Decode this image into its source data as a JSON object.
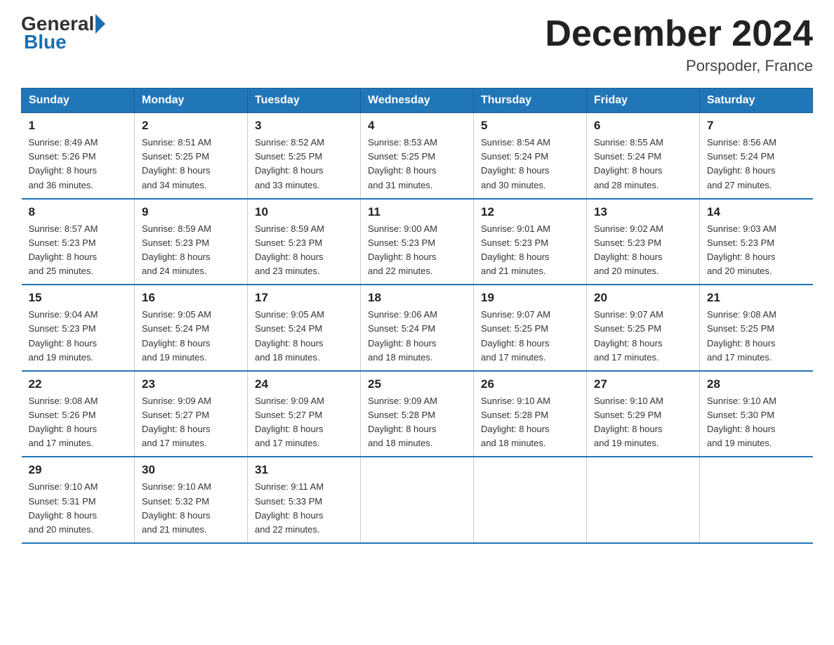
{
  "logo": {
    "text_general": "General",
    "text_blue": "Blue"
  },
  "title": "December 2024",
  "location": "Porspoder, France",
  "days_of_week": [
    "Sunday",
    "Monday",
    "Tuesday",
    "Wednesday",
    "Thursday",
    "Friday",
    "Saturday"
  ],
  "weeks": [
    [
      {
        "num": "1",
        "info": "Sunrise: 8:49 AM\nSunset: 5:26 PM\nDaylight: 8 hours\nand 36 minutes."
      },
      {
        "num": "2",
        "info": "Sunrise: 8:51 AM\nSunset: 5:25 PM\nDaylight: 8 hours\nand 34 minutes."
      },
      {
        "num": "3",
        "info": "Sunrise: 8:52 AM\nSunset: 5:25 PM\nDaylight: 8 hours\nand 33 minutes."
      },
      {
        "num": "4",
        "info": "Sunrise: 8:53 AM\nSunset: 5:25 PM\nDaylight: 8 hours\nand 31 minutes."
      },
      {
        "num": "5",
        "info": "Sunrise: 8:54 AM\nSunset: 5:24 PM\nDaylight: 8 hours\nand 30 minutes."
      },
      {
        "num": "6",
        "info": "Sunrise: 8:55 AM\nSunset: 5:24 PM\nDaylight: 8 hours\nand 28 minutes."
      },
      {
        "num": "7",
        "info": "Sunrise: 8:56 AM\nSunset: 5:24 PM\nDaylight: 8 hours\nand 27 minutes."
      }
    ],
    [
      {
        "num": "8",
        "info": "Sunrise: 8:57 AM\nSunset: 5:23 PM\nDaylight: 8 hours\nand 25 minutes."
      },
      {
        "num": "9",
        "info": "Sunrise: 8:59 AM\nSunset: 5:23 PM\nDaylight: 8 hours\nand 24 minutes."
      },
      {
        "num": "10",
        "info": "Sunrise: 8:59 AM\nSunset: 5:23 PM\nDaylight: 8 hours\nand 23 minutes."
      },
      {
        "num": "11",
        "info": "Sunrise: 9:00 AM\nSunset: 5:23 PM\nDaylight: 8 hours\nand 22 minutes."
      },
      {
        "num": "12",
        "info": "Sunrise: 9:01 AM\nSunset: 5:23 PM\nDaylight: 8 hours\nand 21 minutes."
      },
      {
        "num": "13",
        "info": "Sunrise: 9:02 AM\nSunset: 5:23 PM\nDaylight: 8 hours\nand 20 minutes."
      },
      {
        "num": "14",
        "info": "Sunrise: 9:03 AM\nSunset: 5:23 PM\nDaylight: 8 hours\nand 20 minutes."
      }
    ],
    [
      {
        "num": "15",
        "info": "Sunrise: 9:04 AM\nSunset: 5:23 PM\nDaylight: 8 hours\nand 19 minutes."
      },
      {
        "num": "16",
        "info": "Sunrise: 9:05 AM\nSunset: 5:24 PM\nDaylight: 8 hours\nand 19 minutes."
      },
      {
        "num": "17",
        "info": "Sunrise: 9:05 AM\nSunset: 5:24 PM\nDaylight: 8 hours\nand 18 minutes."
      },
      {
        "num": "18",
        "info": "Sunrise: 9:06 AM\nSunset: 5:24 PM\nDaylight: 8 hours\nand 18 minutes."
      },
      {
        "num": "19",
        "info": "Sunrise: 9:07 AM\nSunset: 5:25 PM\nDaylight: 8 hours\nand 17 minutes."
      },
      {
        "num": "20",
        "info": "Sunrise: 9:07 AM\nSunset: 5:25 PM\nDaylight: 8 hours\nand 17 minutes."
      },
      {
        "num": "21",
        "info": "Sunrise: 9:08 AM\nSunset: 5:25 PM\nDaylight: 8 hours\nand 17 minutes."
      }
    ],
    [
      {
        "num": "22",
        "info": "Sunrise: 9:08 AM\nSunset: 5:26 PM\nDaylight: 8 hours\nand 17 minutes."
      },
      {
        "num": "23",
        "info": "Sunrise: 9:09 AM\nSunset: 5:27 PM\nDaylight: 8 hours\nand 17 minutes."
      },
      {
        "num": "24",
        "info": "Sunrise: 9:09 AM\nSunset: 5:27 PM\nDaylight: 8 hours\nand 17 minutes."
      },
      {
        "num": "25",
        "info": "Sunrise: 9:09 AM\nSunset: 5:28 PM\nDaylight: 8 hours\nand 18 minutes."
      },
      {
        "num": "26",
        "info": "Sunrise: 9:10 AM\nSunset: 5:28 PM\nDaylight: 8 hours\nand 18 minutes."
      },
      {
        "num": "27",
        "info": "Sunrise: 9:10 AM\nSunset: 5:29 PM\nDaylight: 8 hours\nand 19 minutes."
      },
      {
        "num": "28",
        "info": "Sunrise: 9:10 AM\nSunset: 5:30 PM\nDaylight: 8 hours\nand 19 minutes."
      }
    ],
    [
      {
        "num": "29",
        "info": "Sunrise: 9:10 AM\nSunset: 5:31 PM\nDaylight: 8 hours\nand 20 minutes."
      },
      {
        "num": "30",
        "info": "Sunrise: 9:10 AM\nSunset: 5:32 PM\nDaylight: 8 hours\nand 21 minutes."
      },
      {
        "num": "31",
        "info": "Sunrise: 9:11 AM\nSunset: 5:33 PM\nDaylight: 8 hours\nand 22 minutes."
      },
      {
        "num": "",
        "info": ""
      },
      {
        "num": "",
        "info": ""
      },
      {
        "num": "",
        "info": ""
      },
      {
        "num": "",
        "info": ""
      }
    ]
  ]
}
